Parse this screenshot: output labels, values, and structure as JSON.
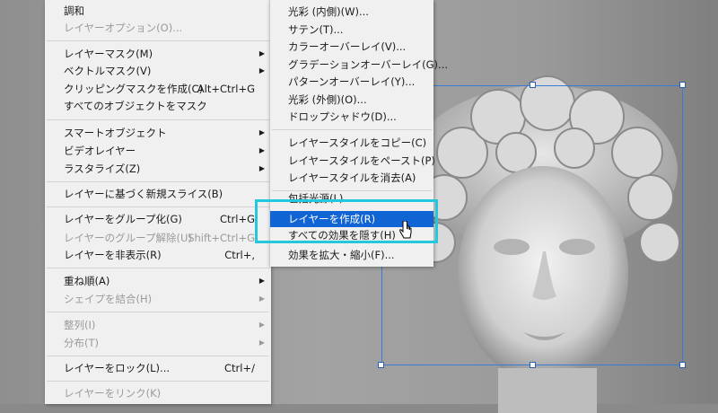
{
  "main_menu": {
    "items": [
      {
        "label": "調和",
        "disabled": false
      },
      {
        "label": "レイヤーオプション(O)...",
        "disabled": true
      },
      {
        "label": "レイヤーマスク(M)",
        "submenu": true
      },
      {
        "label": "ベクトルマスク(V)",
        "submenu": true
      },
      {
        "label": "クリッピングマスクを作成(C)",
        "shortcut": "Alt+Ctrl+G"
      },
      {
        "label": "すべてのオブジェクトをマスク"
      },
      {
        "label": "スマートオブジェクト",
        "submenu": true
      },
      {
        "label": "ビデオレイヤー",
        "submenu": true
      },
      {
        "label": "ラスタライズ(Z)",
        "submenu": true
      },
      {
        "label": "レイヤーに基づく新規スライス(B)"
      },
      {
        "label": "レイヤーをグループ化(G)",
        "shortcut": "Ctrl+G"
      },
      {
        "label": "レイヤーのグループ解除(U)",
        "shortcut": "Shift+Ctrl+G",
        "disabled": true
      },
      {
        "label": "レイヤーを非表示(R)",
        "shortcut": "Ctrl+,"
      },
      {
        "label": "重ね順(A)",
        "submenu": true
      },
      {
        "label": "シェイプを結合(H)",
        "submenu": true,
        "disabled": true
      },
      {
        "label": "整列(I)",
        "submenu": true,
        "disabled": true
      },
      {
        "label": "分布(T)",
        "submenu": true,
        "disabled": true
      },
      {
        "label": "レイヤーをロック(L)...",
        "shortcut": "Ctrl+/"
      },
      {
        "label": "レイヤーをリンク(K)",
        "disabled": true
      }
    ]
  },
  "sub_menu": {
    "items": [
      {
        "label": "光彩 (内側)(W)..."
      },
      {
        "label": "サテン(T)..."
      },
      {
        "label": "カラーオーバーレイ(V)..."
      },
      {
        "label": "グラデーションオーバーレイ(G)..."
      },
      {
        "label": "パターンオーバーレイ(Y)..."
      },
      {
        "label": "光彩 (外側)(O)..."
      },
      {
        "label": "ドロップシャドウ(D)..."
      },
      {
        "label": "レイヤースタイルをコピー(C)"
      },
      {
        "label": "レイヤースタイルをペースト(P)"
      },
      {
        "label": "レイヤースタイルを消去(A)"
      },
      {
        "label": "包括光源(L)..."
      },
      {
        "label": "レイヤーを作成(R)",
        "highlighted": true
      },
      {
        "label": "すべての効果を隠す(H)"
      },
      {
        "label": "効果を拡大・縮小(F)..."
      }
    ]
  },
  "colors": {
    "menu_bg": "#f0f0f0",
    "highlight": "#1064d4",
    "callout": "#23c8dc",
    "selection": "#3a7bd5"
  },
  "icons": {
    "submenu_arrow": "▶",
    "cursor": "pointer-hand-icon"
  }
}
